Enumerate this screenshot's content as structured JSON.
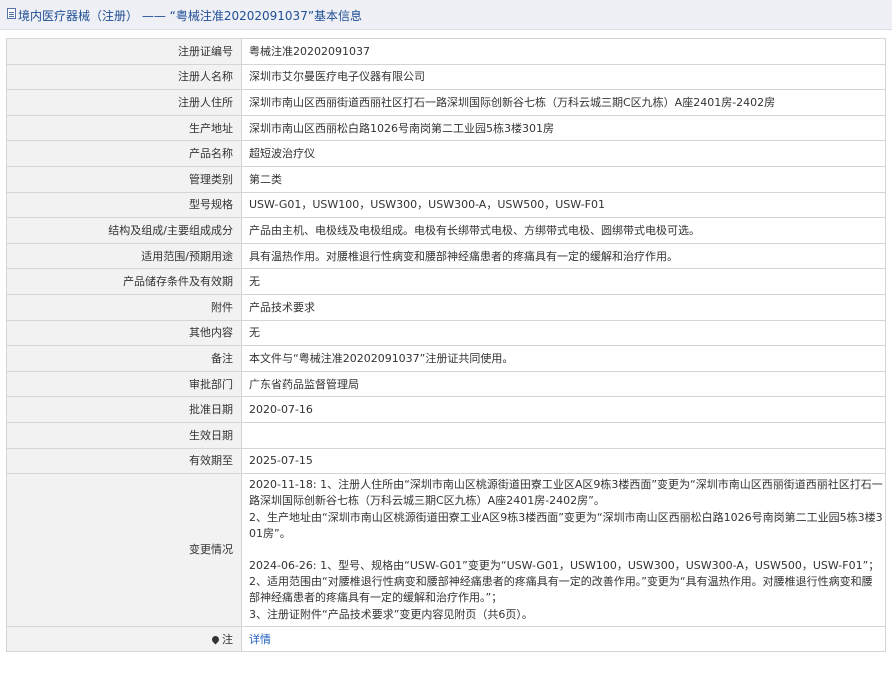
{
  "header": {
    "title": "境内医疗器械（注册） —— “粤械注准20202091037”基本信息"
  },
  "rows": [
    {
      "label": "注册证编号",
      "value": "粤械注准20202091037"
    },
    {
      "label": "注册人名称",
      "value": "深圳市艾尔曼医疗电子仪器有限公司"
    },
    {
      "label": "注册人住所",
      "value": "深圳市南山区西丽街道西丽社区打石一路深圳国际创新谷七栋（万科云城三期C区九栋）A座2401房-2402房"
    },
    {
      "label": "生产地址",
      "value": "深圳市南山区西丽松白路1026号南岗第二工业园5栋3楼301房"
    },
    {
      "label": "产品名称",
      "value": "超短波治疗仪"
    },
    {
      "label": "管理类别",
      "value": "第二类"
    },
    {
      "label": "型号规格",
      "value": "USW-G01，USW100，USW300，USW300-A，USW500，USW-F01"
    },
    {
      "label": "结构及组成/主要组成成分",
      "value": "产品由主机、电极线及电极组成。电极有长绑带式电极、方绑带式电极、圆绑带式电极可选。"
    },
    {
      "label": "适用范围/预期用途",
      "value": "具有温热作用。对腰椎退行性病变和腰部神经痛患者的疼痛具有一定的缓解和治疗作用。"
    },
    {
      "label": "产品储存条件及有效期",
      "value": "无"
    },
    {
      "label": "附件",
      "value": "产品技术要求"
    },
    {
      "label": "其他内容",
      "value": "无"
    },
    {
      "label": "备注",
      "value": "本文件与“粤械注准20202091037”注册证共同使用。"
    },
    {
      "label": "审批部门",
      "value": "广东省药品监督管理局"
    },
    {
      "label": "批准日期",
      "value": "2020-07-16"
    },
    {
      "label": "生效日期",
      "value": ""
    },
    {
      "label": "有效期至",
      "value": "2025-07-15"
    }
  ],
  "changes": {
    "label": "变更情况",
    "lines": [
      "2020-11-18: 1、注册人住所由“深圳市南山区桃源街道田寮工业区A区9栋3楼西面”变更为“深圳市南山区西丽街道西丽社区打石一",
      "路深圳国际创新谷七栋（万科云城三期C区九栋）A座2401房-2402房”。",
      "2、生产地址由“深圳市南山区桃源街道田寮工业A区9栋3楼西面”变更为“深圳市南山区西丽松白路1026号南岗第二工业园5栋3楼3",
      "01房”。",
      "",
      "2024-06-26: 1、型号、规格由“USW-G01”变更为“USW-G01，USW100，USW300，USW300-A，USW500，USW-F01”；",
      "2、适用范围由“对腰椎退行性病变和腰部神经痛患者的疼痛具有一定的改善作用。”变更为“具有温热作用。对腰椎退行性病变和腰",
      "部神经痛患者的疼痛具有一定的缓解和治疗作用。”；",
      "3、注册证附件“产品技术要求”变更内容见附页（共6页）。"
    ]
  },
  "note": {
    "label": "注",
    "link": "详情"
  }
}
